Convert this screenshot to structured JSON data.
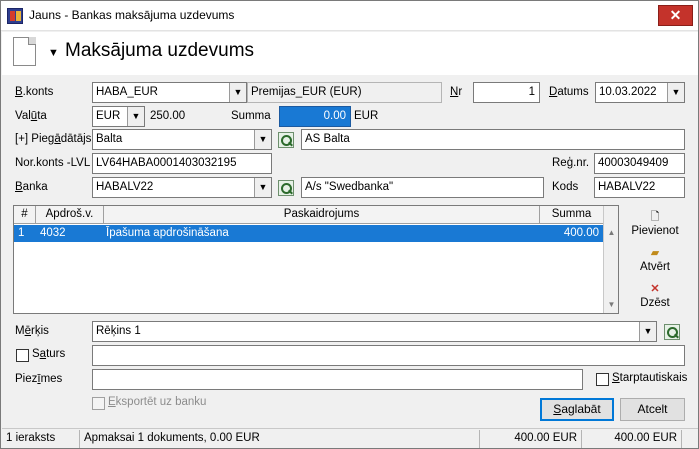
{
  "window": {
    "title": "Jauns - Bankas maksājuma uzdevums",
    "close_label": "✕"
  },
  "header": {
    "title": "Maksājuma uzdevums"
  },
  "form": {
    "bkonts": {
      "label": "B.konts",
      "value": "HABA_EUR",
      "description": "Premijas_EUR (EUR)"
    },
    "nr": {
      "label": "Nr",
      "value": "1"
    },
    "datums": {
      "label": "Datums",
      "value": "10.03.2022"
    },
    "valuta": {
      "label": "Valūta",
      "value": "EUR",
      "amount": "250.00"
    },
    "summa": {
      "label": "Summa",
      "value": "0.00",
      "currency": "EUR"
    },
    "piegadatajs": {
      "label": "[+] Piegādātājs",
      "value": "Balta",
      "name": "AS Balta"
    },
    "norkonts": {
      "label": "Nor.konts -LVL",
      "value": "LV64HABA0001403032195"
    },
    "regnr": {
      "label": "Reģ.nr.",
      "value": "40003049409"
    },
    "banka": {
      "label": "Banka",
      "value": "HABALV22",
      "name": "A/s \"Swedbanka\""
    },
    "kods": {
      "label": "Kods",
      "value": "HABALV22"
    },
    "merkis": {
      "label": "Mērķis",
      "value": "Rēķins 1"
    },
    "saturs": {
      "label": "Saturs",
      "value": ""
    },
    "piezimes": {
      "label": "Piezīmes",
      "value": ""
    },
    "starptautiskais": {
      "label": "Starptautiskais"
    },
    "eksportet": {
      "label": "Eksportēt uz banku"
    }
  },
  "grid": {
    "headers": [
      "#",
      "Apdroš.v.",
      "Paskaidrojums",
      "Summa"
    ],
    "rows": [
      {
        "num": "1",
        "code": "4032",
        "desc": "Īpašuma apdrošināšana",
        "sum": "400.00"
      }
    ]
  },
  "side_buttons": {
    "add": "Pievienot",
    "open": "Atvērt",
    "delete": "Dzēst"
  },
  "buttons": {
    "save": "Saglabāt",
    "cancel": "Atcelt"
  },
  "status": {
    "records": "1 ieraksts",
    "summary": "Apmaksai 1 dokuments, 0.00 EUR",
    "total1": "400.00 EUR",
    "total2": "400.00 EUR"
  }
}
